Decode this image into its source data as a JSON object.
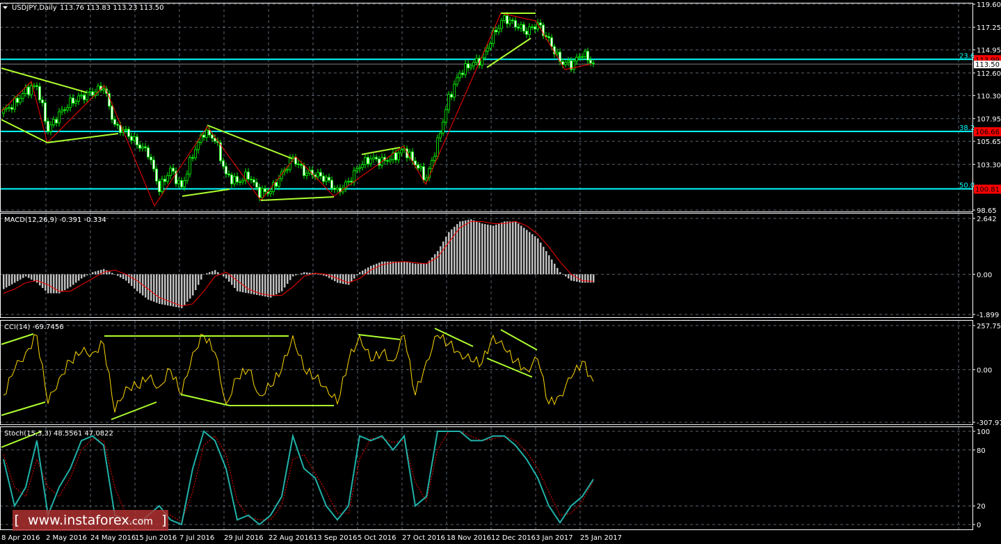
{
  "header": {
    "symbol": "USDJPY,Daily",
    "ohlc": "113.76 113.83 113.23 113.50"
  },
  "watermark": {
    "open": "[",
    "www": "www.instaforex",
    "com": ".com",
    "close": "]"
  },
  "colors": {
    "fib": "#00ffff",
    "zigzag": "#ff0000",
    "trend": "#adff2f",
    "macd_hist": "#c0c0c0",
    "cci": "#ffd700",
    "stoch_main": "#20b2aa",
    "stoch_signal": "#ff0000",
    "price_label": "#ff0000"
  },
  "chart_data": [
    {
      "type": "candlestick",
      "title": "USDJPY,Daily",
      "x_dates": [
        "8 Apr 2016",
        "2 May 2016",
        "24 May 2016",
        "15 Jun 2016",
        "7 Jul 2016",
        "29 Jul 2016",
        "22 Aug 2016",
        "13 Sep 2016",
        "5 Oct 2016",
        "27 Oct 2016",
        "18 Nov 2016",
        "12 Dec 2016",
        "3 Jan 2017",
        "25 Jan 2017"
      ],
      "y_ticks": [
        "119.60",
        "117.25",
        "114.95",
        "112.60",
        "110.30",
        "107.95",
        "105.65",
        "103.30",
        "98.65"
      ],
      "ylim": [
        98.65,
        119.6
      ],
      "current_price": "113.50",
      "fib_levels": [
        {
          "level": "23.6",
          "price": "113.99",
          "value": 113.99
        },
        {
          "level": "38.2",
          "price": "106.66",
          "value": 106.66
        },
        {
          "level": "50.0",
          "price": "100.81",
          "value": 100.81
        }
      ],
      "closes": [
        108.7,
        109.5,
        110.8,
        111.3,
        106.8,
        108.4,
        109.6,
        110.2,
        110.6,
        111.2,
        107.2,
        106.6,
        105.4,
        104.5,
        100.8,
        102.8,
        100.9,
        104.3,
        106.6,
        105.9,
        102.2,
        101.5,
        102.2,
        100.4,
        100.6,
        102.3,
        104.0,
        102.5,
        102.3,
        101.8,
        100.5,
        101.5,
        103.2,
        103.9,
        103.6,
        104.0,
        104.8,
        103.4,
        101.8,
        105.5,
        110.0,
        112.6,
        113.5,
        114.0,
        116.5,
        118.2,
        117.5,
        116.8,
        117.6,
        115.9,
        113.8,
        113.4,
        114.6,
        113.5
      ]
    },
    {
      "type": "bar",
      "title": "MACD(12,26,9) -0.391 -0.334",
      "y_ticks": [
        "2.642",
        "0.00",
        "-1.899"
      ],
      "ylim": [
        -1.899,
        2.642
      ],
      "histogram": [
        -0.7,
        -0.4,
        -0.1,
        -0.4,
        -0.9,
        -0.9,
        -0.6,
        -0.2,
        0.1,
        0.25,
        0.0,
        -0.3,
        -0.8,
        -1.2,
        -1.4,
        -1.5,
        -1.6,
        -1.0,
        0.0,
        0.2,
        -0.2,
        -0.8,
        -0.9,
        -1.0,
        -1.1,
        -0.8,
        -0.1,
        0.1,
        0.05,
        -0.1,
        -0.4,
        -0.5,
        0.1,
        0.4,
        0.6,
        0.6,
        0.6,
        0.5,
        0.5,
        1.1,
        2.0,
        2.5,
        2.6,
        2.4,
        2.3,
        2.5,
        2.5,
        2.1,
        1.7,
        0.9,
        0.1,
        -0.3,
        -0.4,
        -0.391
      ],
      "signal": [
        -0.9,
        -0.7,
        -0.4,
        -0.3,
        -0.5,
        -0.8,
        -0.8,
        -0.5,
        -0.2,
        0.1,
        0.2,
        0.0,
        -0.3,
        -0.7,
        -1.1,
        -1.3,
        -1.5,
        -1.4,
        -0.8,
        -0.1,
        0.1,
        -0.3,
        -0.7,
        -0.9,
        -1.0,
        -1.0,
        -0.6,
        -0.1,
        0.05,
        0.0,
        -0.2,
        -0.4,
        -0.2,
        0.2,
        0.45,
        0.55,
        0.6,
        0.55,
        0.5,
        0.8,
        1.5,
        2.2,
        2.5,
        2.5,
        2.4,
        2.4,
        2.5,
        2.3,
        1.9,
        1.3,
        0.6,
        0.0,
        -0.3,
        -0.334
      ]
    },
    {
      "type": "line",
      "title": "CCI(14) -69.7456",
      "y_ticks": [
        "257.7586",
        "0.00",
        "-307.971"
      ],
      "ylim": [
        -307.971,
        257.7586
      ],
      "values": [
        -150,
        0,
        100,
        200,
        -200,
        -50,
        50,
        100,
        100,
        150,
        -250,
        -100,
        -100,
        -50,
        -100,
        0,
        -150,
        100,
        200,
        100,
        -200,
        -50,
        0,
        -150,
        -100,
        0,
        200,
        0,
        -50,
        -100,
        -200,
        50,
        200,
        50,
        100,
        50,
        200,
        -150,
        50,
        200,
        150,
        100,
        50,
        40,
        200,
        120,
        50,
        0,
        60,
        -200,
        -150,
        -50,
        50,
        -69.7
      ]
    },
    {
      "type": "line",
      "title": "Stoch(15,3,3) 48.5561 47.0822",
      "y_ticks": [
        "100",
        "80",
        "20",
        "0"
      ],
      "ylim": [
        0,
        100
      ],
      "main": [
        70,
        20,
        40,
        90,
        10,
        40,
        60,
        90,
        95,
        85,
        10,
        5,
        0,
        10,
        20,
        5,
        0,
        60,
        100,
        90,
        60,
        5,
        10,
        0,
        10,
        30,
        95,
        60,
        50,
        20,
        5,
        20,
        95,
        90,
        95,
        80,
        95,
        20,
        30,
        100,
        100,
        100,
        90,
        90,
        95,
        95,
        85,
        70,
        50,
        20,
        2,
        20,
        30,
        48.6
      ],
      "signal": [
        75,
        40,
        30,
        70,
        40,
        30,
        50,
        80,
        92,
        90,
        40,
        10,
        3,
        5,
        15,
        10,
        3,
        35,
        85,
        95,
        75,
        25,
        8,
        5,
        5,
        20,
        70,
        75,
        55,
        35,
        12,
        12,
        70,
        92,
        93,
        88,
        90,
        45,
        25,
        80,
        100,
        100,
        95,
        90,
        92,
        95,
        90,
        78,
        60,
        35,
        10,
        12,
        25,
        47.1
      ]
    }
  ]
}
